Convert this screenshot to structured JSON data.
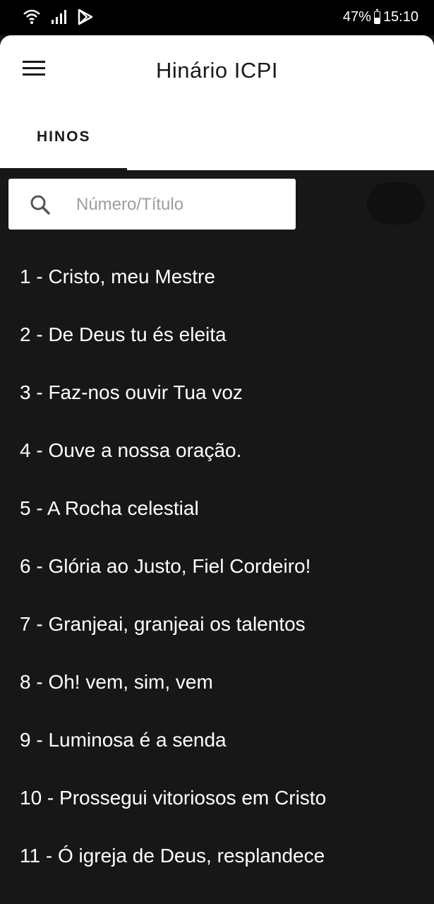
{
  "status_bar": {
    "icons": [
      "wifi-icon",
      "signal-icon",
      "play-store-icon"
    ],
    "battery": "47%",
    "battery_level": 0.47,
    "time": "15:10"
  },
  "app_bar": {
    "menu_icon": "menu-icon",
    "title": "Hinário ICPI",
    "tabs": [
      {
        "label": "HINOS",
        "selected": true
      }
    ]
  },
  "search": {
    "icon": "search-icon",
    "placeholder": "Número/Título",
    "value": ""
  },
  "hymns": [
    {
      "label": "1 - Cristo, meu Mestre"
    },
    {
      "label": "2 - De Deus tu és eleita"
    },
    {
      "label": "3 - Faz-nos ouvir Tua voz"
    },
    {
      "label": "4 - Ouve a nossa oração."
    },
    {
      "label": "5 - A Rocha celestial"
    },
    {
      "label": "6 - Glória ao Justo, Fiel Cordeiro!"
    },
    {
      "label": "7 - Granjeai, granjeai os talentos"
    },
    {
      "label": "8 - Oh! vem, sim, vem"
    },
    {
      "label": "9 - Luminosa é a senda"
    },
    {
      "label": "10 - Prossegui vitoriosos em Cristo"
    },
    {
      "label": "11 - Ó igreja de Deus, resplandece"
    }
  ],
  "colors": {
    "background": "#171717",
    "app_bar": "#ffffff",
    "text_light": "#ffffff",
    "text_dark": "#1a1a1a",
    "placeholder": "#9e9e9e"
  }
}
